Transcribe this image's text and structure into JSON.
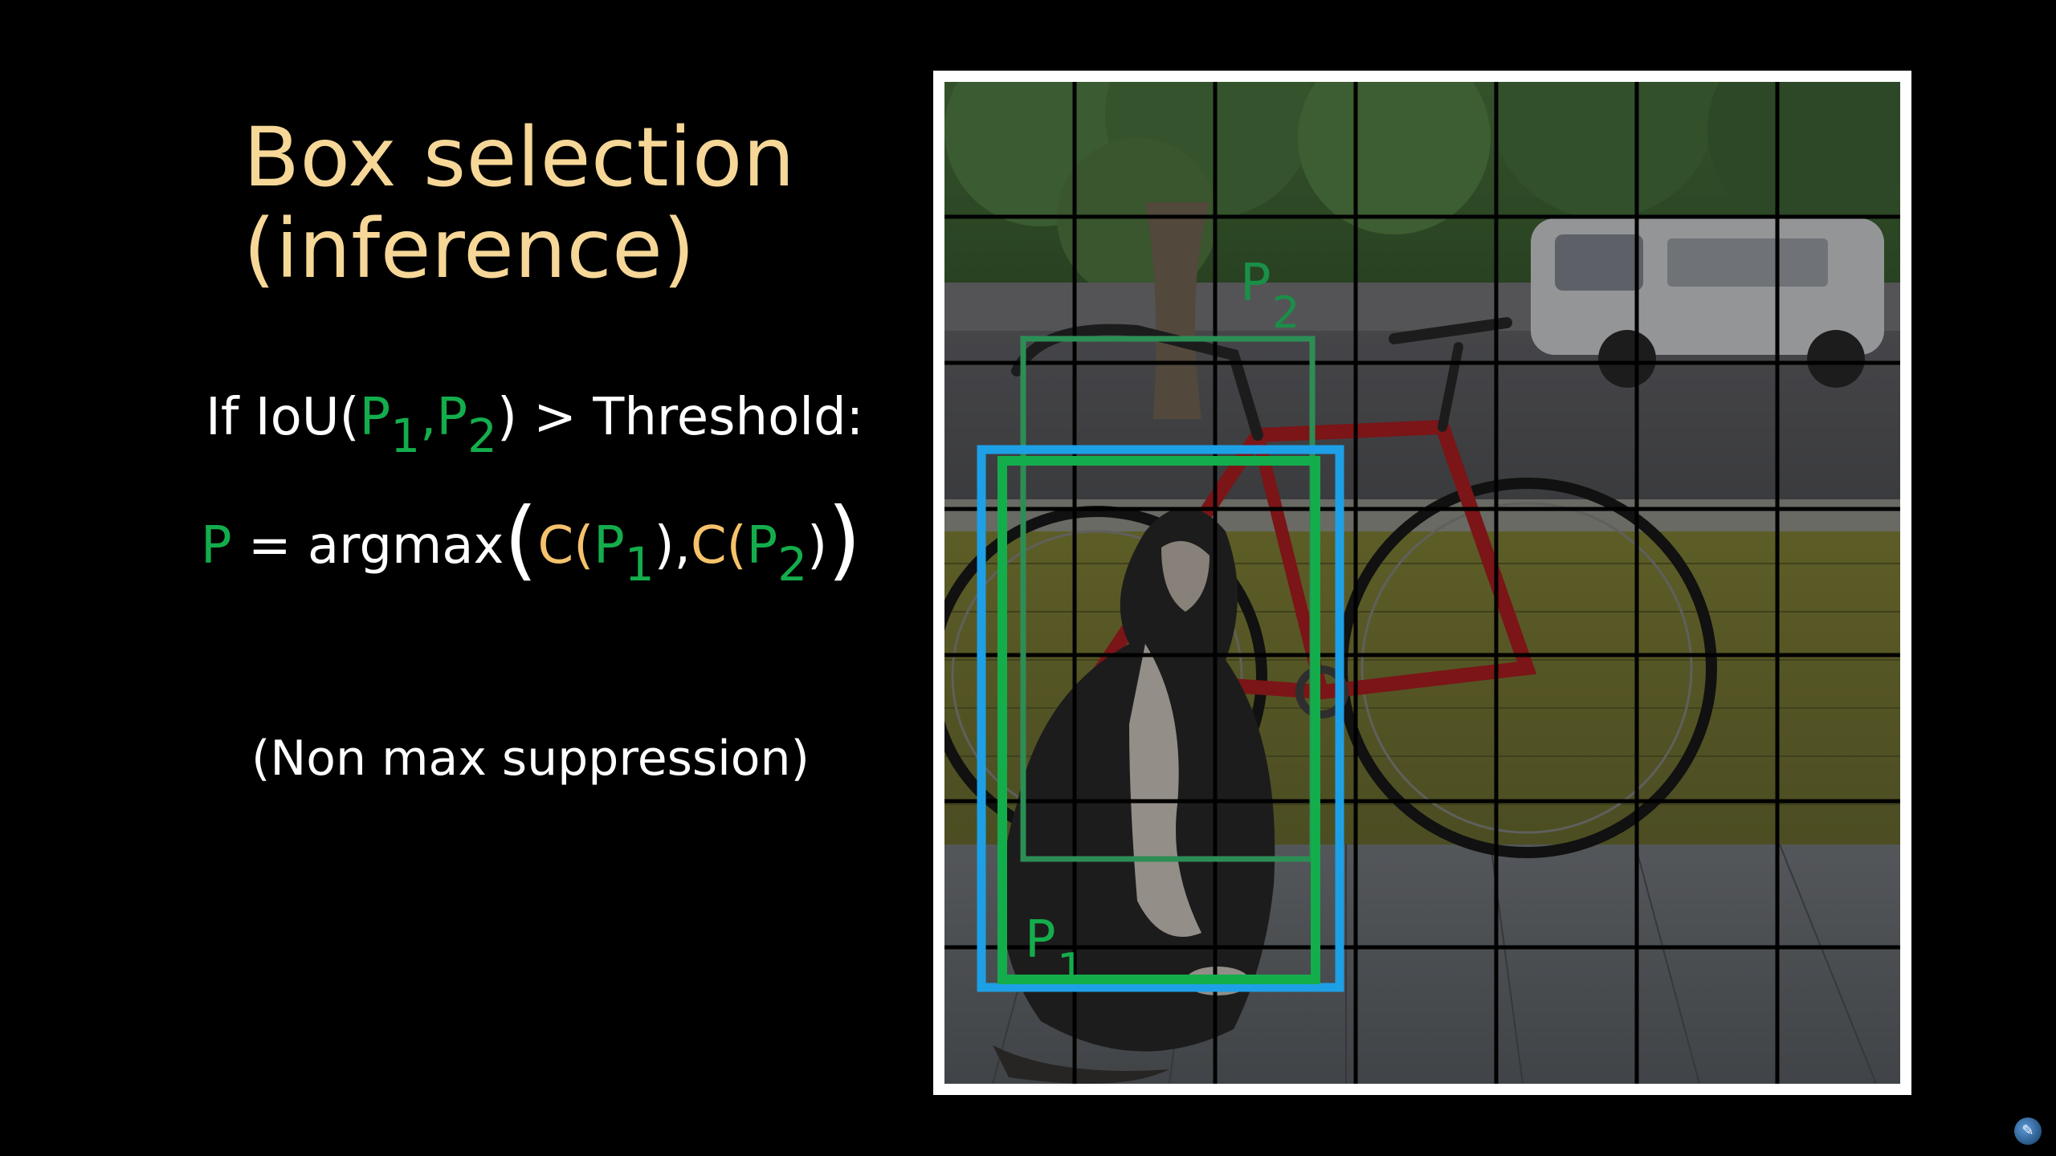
{
  "slide": {
    "title_line1": "Box selection",
    "title_line2": "(inference)",
    "condition": {
      "prefix": "If IoU(",
      "p1": "P",
      "p1_sub": "1",
      "comma": ",",
      "p2": "P",
      "p2_sub": "2",
      "suffix": ") > Threshold:"
    },
    "formula": {
      "p": "P",
      "equals_argmax": " = argmax",
      "open_big": "(",
      "c1": "C(",
      "c1_p": "P",
      "c1_sub": "1",
      "c1_close": ")",
      "comma": ",",
      "c2": "C(",
      "c2_p": "P",
      "c2_sub": "2",
      "c2_close": ")",
      "close_big": ")"
    },
    "note": "(Non max suppression)"
  },
  "figure": {
    "grid": {
      "rows": 7,
      "cols": 7
    },
    "labels": {
      "p1": "P",
      "p1_sub": "1",
      "p2": "P",
      "p2_sub": "2"
    },
    "colors": {
      "green_box": "#14ad4c",
      "green_faded": "#2c8e55",
      "blue_box": "#1ea0e6",
      "grid": "#000000",
      "frame": "#ffffff"
    }
  },
  "colors": {
    "background": "#000000",
    "title": "#f6d797",
    "text": "#ffffff",
    "accent_green": "#14ad4c",
    "accent_gold": "#f6c26a"
  }
}
